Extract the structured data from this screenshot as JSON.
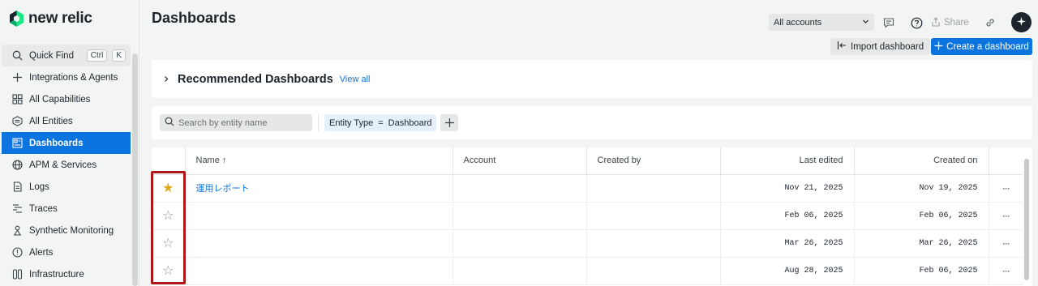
{
  "app": {
    "logo_text": "new relic"
  },
  "sidebar": {
    "items": [
      {
        "label": "Quick Find",
        "icon": "search-icon",
        "keys": [
          "Ctrl",
          "K"
        ]
      },
      {
        "label": "Integrations & Agents",
        "icon": "plus-icon"
      },
      {
        "label": "All Capabilities",
        "icon": "grid-icon"
      },
      {
        "label": "All Entities",
        "icon": "hexagon-icon"
      },
      {
        "label": "Dashboards",
        "icon": "dashboard-icon",
        "active": true
      },
      {
        "label": "APM & Services",
        "icon": "globe-icon"
      },
      {
        "label": "Logs",
        "icon": "document-icon"
      },
      {
        "label": "Traces",
        "icon": "traces-icon"
      },
      {
        "label": "Synthetic Monitoring",
        "icon": "synthetics-icon"
      },
      {
        "label": "Alerts",
        "icon": "alert-icon"
      },
      {
        "label": "Infrastructure",
        "icon": "infrastructure-icon"
      }
    ]
  },
  "header": {
    "title": "Dashboards",
    "account_select": "All accounts",
    "share_label": "Share",
    "import_label": "Import dashboard",
    "create_label": "Create a dashboard"
  },
  "recommended": {
    "title": "Recommended Dashboards",
    "link": "View all"
  },
  "filter": {
    "search_placeholder": "Search by entity name",
    "chip_key": "Entity Type",
    "chip_op": "=",
    "chip_value": "Dashboard"
  },
  "table": {
    "columns": [
      "Name ↑",
      "Account",
      "Created by",
      "Last edited",
      "Created on"
    ],
    "rows": [
      {
        "favorite": true,
        "name": "運用レポート",
        "account": "",
        "created_by": "",
        "last_edited": "Nov 21, 2025",
        "created_on": "Nov 19, 2025"
      },
      {
        "favorite": false,
        "name": "",
        "account": "",
        "created_by": "",
        "last_edited": "Feb 06, 2025",
        "created_on": "Feb 06, 2025"
      },
      {
        "favorite": false,
        "name": "",
        "account": "",
        "created_by": "",
        "last_edited": "Mar 26, 2025",
        "created_on": "Mar 26, 2025"
      },
      {
        "favorite": false,
        "name": "",
        "account": "",
        "created_by": "",
        "last_edited": "Aug 28, 2025",
        "created_on": "Feb 06, 2025"
      }
    ],
    "row_menu": "···"
  },
  "colors": {
    "accent": "#0c74df",
    "star_on": "#e0a81b",
    "highlight": "#b0171b"
  }
}
